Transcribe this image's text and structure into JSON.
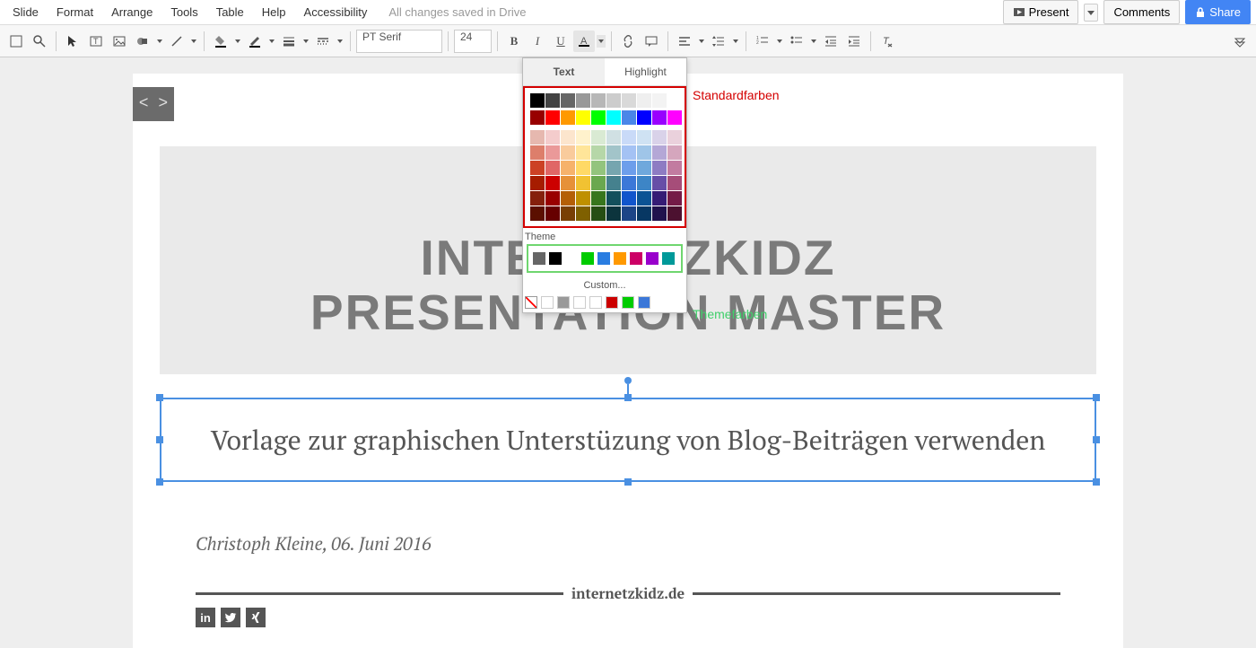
{
  "menubar": {
    "items": [
      "Slide",
      "Format",
      "Arrange",
      "Tools",
      "Table",
      "Help",
      "Accessibility"
    ],
    "status": "All changes saved in Drive",
    "present": "Present",
    "comments": "Comments",
    "share": "Share"
  },
  "toolbar": {
    "font_name": "PT Serif",
    "font_size": "24"
  },
  "slide": {
    "title_line1": "INTERNETZKIDZ",
    "title_line2": "PRESENTATION MASTER",
    "subtitle": "Vorlage zur graphischen Unterstüzung von Blog-Beiträgen verwenden",
    "author": "Christoph Kleine, 06. Juni 2016",
    "domain": "internetzkidz.de",
    "social": [
      "in",
      "t",
      "x"
    ]
  },
  "color_picker": {
    "tab_text": "Text",
    "tab_highlight": "Highlight",
    "annot_standard": "Standardfarben",
    "annot_theme": "Themefarben",
    "theme_label": "Theme",
    "custom_label": "Custom...",
    "grays": [
      "#000000",
      "#434343",
      "#666666",
      "#999999",
      "#b7b7b7",
      "#cccccc",
      "#d9d9d9",
      "#efefef",
      "#f3f3f3",
      "#ffffff"
    ],
    "standard": [
      "#980000",
      "#ff0000",
      "#ff9900",
      "#ffff00",
      "#00ff00",
      "#00ffff",
      "#4a86e8",
      "#0000ff",
      "#9900ff",
      "#ff00ff"
    ],
    "tints": [
      [
        "#e6b8af",
        "#f4cccc",
        "#fce5cd",
        "#fff2cc",
        "#d9ead3",
        "#d0e0e3",
        "#c9daf8",
        "#cfe2f3",
        "#d9d2e9",
        "#ead1dc"
      ],
      [
        "#dd7e6b",
        "#ea9999",
        "#f9cb9c",
        "#ffe599",
        "#b6d7a8",
        "#a2c4c9",
        "#a4c2f4",
        "#9fc5e8",
        "#b4a7d6",
        "#d5a6bd"
      ],
      [
        "#cc4125",
        "#e06666",
        "#f6b26b",
        "#ffd966",
        "#93c47d",
        "#76a5af",
        "#6d9eeb",
        "#6fa8dc",
        "#8e7cc3",
        "#c27ba0"
      ],
      [
        "#a61c00",
        "#cc0000",
        "#e69138",
        "#f1c232",
        "#6aa84f",
        "#45818e",
        "#3c78d8",
        "#3d85c6",
        "#674ea7",
        "#a64d79"
      ],
      [
        "#85200c",
        "#990000",
        "#b45f06",
        "#bf9000",
        "#38761d",
        "#134f5c",
        "#1155cc",
        "#0b5394",
        "#351c75",
        "#741b47"
      ],
      [
        "#5b0f00",
        "#660000",
        "#783f04",
        "#7f6000",
        "#274e13",
        "#0c343d",
        "#1c4587",
        "#073763",
        "#20124d",
        "#4c1130"
      ]
    ],
    "theme_colors": [
      "#666666",
      "#000000",
      "#ffffff",
      "#00cc00",
      "#2a7de1",
      "#ff9900",
      "#cc0066",
      "#9900cc",
      "#009999"
    ],
    "custom_colors": [
      "#ffffff",
      "#999999",
      "#ffffff",
      "#ffffff",
      "#cc0000",
      "#00cc00",
      "#3c78d8"
    ]
  }
}
